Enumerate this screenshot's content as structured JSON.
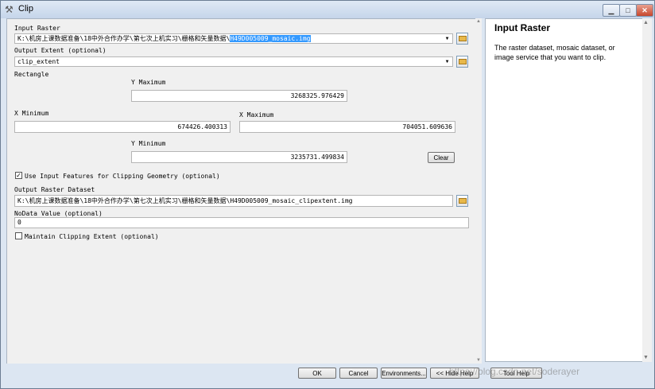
{
  "window": {
    "title": "Clip",
    "min": "▁",
    "max": "□",
    "close": "✕"
  },
  "form": {
    "input_raster": {
      "label": "Input Raster",
      "prefix": "K:\\机房上课数据准备\\18中外合作办学\\第七次上机实习\\栅格和矢量数据\\",
      "selected": "H49D005009_mosaic.img"
    },
    "output_extent": {
      "label": "Output Extent (optional)",
      "value": "clip_extent"
    },
    "rectangle_label": "Rectangle",
    "y_max": {
      "label": "Y Maximum",
      "value": "3268325.976429"
    },
    "x_min": {
      "label": "X Minimum",
      "value": "674426.400313"
    },
    "x_max": {
      "label": "X Maximum",
      "value": "704051.609636"
    },
    "y_min": {
      "label": "Y Minimum",
      "value": "3235731.499834"
    },
    "clear_label": "Clear",
    "use_input_features": {
      "label": "Use Input Features for Clipping Geometry (optional)",
      "checked": true,
      "mark": "✓"
    },
    "output_raster": {
      "label": "Output Raster Dataset",
      "value": "K:\\机房上课数据准备\\18中外合作办学\\第七次上机实习\\栅格和矢量数据\\H49D005009_mosaic_clipextent.img"
    },
    "nodata": {
      "label": "NoData Value (optional)",
      "value": "0"
    },
    "maintain_extent": {
      "label": "Maintain Clipping Extent (optional)",
      "checked": false
    }
  },
  "help": {
    "title": "Input Raster",
    "text": "The raster dataset, mosaic dataset, or image service that you want to clip."
  },
  "buttons": {
    "ok": "OK",
    "cancel": "Cancel",
    "environments": "Environments...",
    "hide_help": "<< Hide Help",
    "tool_help": "Tool Help"
  },
  "watermark": "https://blog.csdn.net/soderayer",
  "icons": {
    "dropdown": "▼",
    "scroll_up": "▲",
    "scroll_down": "▼",
    "tool": "⚒"
  }
}
